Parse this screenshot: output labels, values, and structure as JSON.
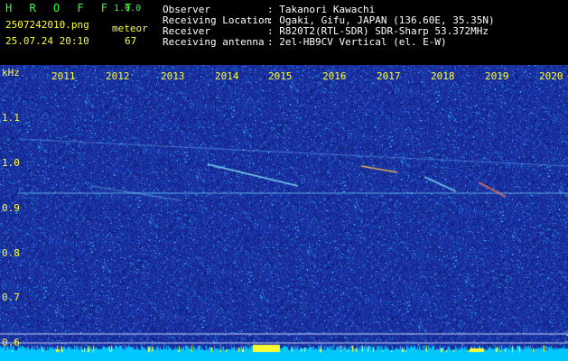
{
  "header": {
    "app_name": "H R O F F T",
    "version": "1.0.0",
    "filename": "2507242010.png",
    "datetime": "25.07.24 20:10",
    "meteor_label": "meteor",
    "meteor_count": "67",
    "observer_label": "Observer",
    "observer_value": ": Takanori Kawachi",
    "location_label": "Receiving Location",
    "location_value": ": Ogaki, Gifu, JAPAN (136.60E, 35.35N)",
    "receiver_label": "Receiver",
    "receiver_value": ": R820T2(RTL-SDR) SDR-Sharp 53.372MHz",
    "antenna_label": "Receiving antenna",
    "antenna_value": ": 2el-HB9CV Vertical (el. E-W)"
  },
  "spectrogram": {
    "unit_label": "kHz",
    "y_ticks": [
      "1.1",
      "1.0",
      "0.9",
      "0.8",
      "0.7",
      "0.6"
    ],
    "x_ticks": [
      "2011",
      "2012",
      "2013",
      "2014",
      "2015",
      "2016",
      "2017",
      "2018",
      "2019",
      "2020"
    ],
    "colors": {
      "background": "#1a2fa0",
      "text_yellow": "#ffff33",
      "text_green": "#33ff33",
      "baseline": "#00c8ff"
    }
  }
}
